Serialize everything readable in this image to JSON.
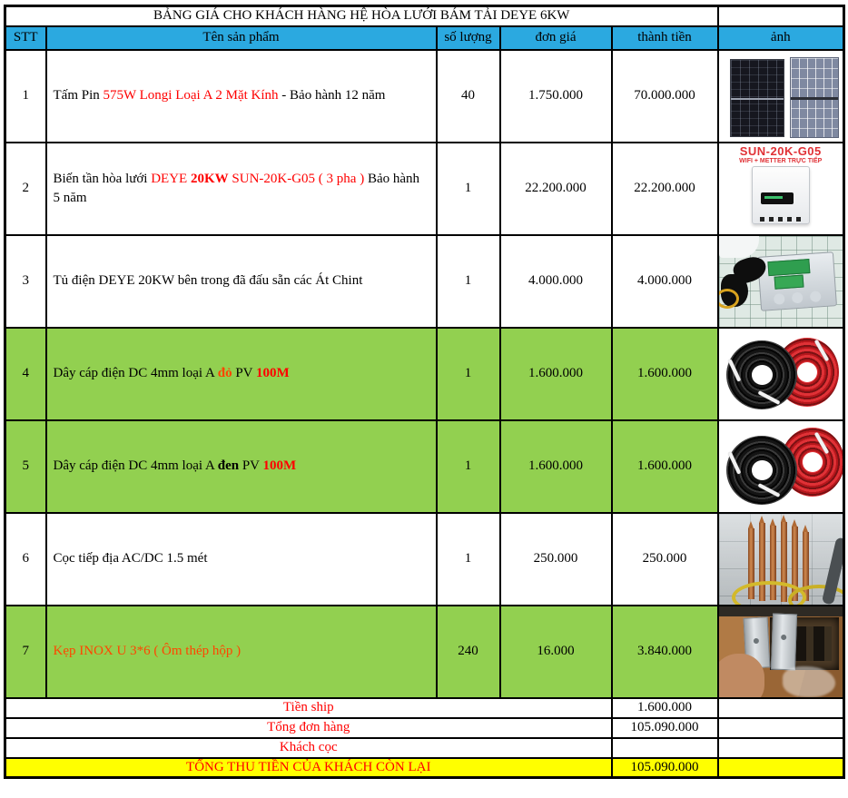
{
  "title": "BẢNG GIÁ CHO KHÁCH HÀNG HỆ HÒA LƯỚI BÁM TẢI DEYE 6KW",
  "columns": {
    "stt": "STT",
    "product": "Tên sản phẩm",
    "qty": "số lượng",
    "unit_price": "đơn giá",
    "total": "thành tiền",
    "image": "ảnh"
  },
  "colors": {
    "header_bg": "#2BA9E0",
    "highlight_green": "#92D050",
    "highlight_yellow": "#FFFF00",
    "red": "#FF0000",
    "orange_red": "#FF4500"
  },
  "rows": [
    {
      "stt": "1",
      "name_parts": [
        {
          "t": "Tấm Pin ",
          "s": "plain"
        },
        {
          "t": "575W Longi Loại A 2 Mặt Kính",
          "s": "red"
        },
        {
          "t": " - Bảo hành 12 năm",
          "s": "plain"
        }
      ],
      "qty": "40",
      "unit_price": "1.750.000",
      "total": "70.000.000",
      "highlight": false,
      "image": "solar-panels"
    },
    {
      "stt": "2",
      "name_parts": [
        {
          "t": "Biến tần hòa lưới ",
          "s": "plain"
        },
        {
          "t": "DEYE ",
          "s": "red"
        },
        {
          "t": "20KW",
          "s": "red-bold"
        },
        {
          "t": " SUN-20K-G05 ( 3 pha ) ",
          "s": "red"
        },
        {
          "t": " Bảo hành 5 năm",
          "s": "plain"
        }
      ],
      "qty": "1",
      "unit_price": "22.200.000",
      "total": "22.200.000",
      "highlight": false,
      "image": "inverter",
      "image_labels": {
        "model": "SUN-20K-G05",
        "subtitle": "WIFI + METTER TRỰC TIẾP"
      }
    },
    {
      "stt": "3",
      "name_parts": [
        {
          "t": "Tủ điện DEYE 20KW bên trong đã đấu sẵn các Át Chint",
          "s": "plain"
        }
      ],
      "qty": "1",
      "unit_price": "4.000.000",
      "total": "4.000.000",
      "highlight": false,
      "image": "electrical-box"
    },
    {
      "stt": "4",
      "name_parts": [
        {
          "t": "Dây cáp điện DC 4mm loại A ",
          "s": "plain"
        },
        {
          "t": "đỏ",
          "s": "orange-bold"
        },
        {
          "t": " PV ",
          "s": "plain"
        },
        {
          "t": "100M",
          "s": "red-bold"
        }
      ],
      "qty": "1",
      "unit_price": "1.600.000",
      "total": "1.600.000",
      "highlight": true,
      "image": "cables-red-black"
    },
    {
      "stt": "5",
      "name_parts": [
        {
          "t": "Dây cáp điện DC 4mm loại A ",
          "s": "plain"
        },
        {
          "t": "đen",
          "s": "bold"
        },
        {
          "t": " PV ",
          "s": "plain"
        },
        {
          "t": "100M",
          "s": "red-bold"
        }
      ],
      "qty": "1",
      "unit_price": "1.600.000",
      "total": "1.600.000",
      "highlight": true,
      "image": "cables-black-red"
    },
    {
      "stt": "6",
      "name_parts": [
        {
          "t": "Cọc tiếp địa AC/DC 1.5 mét",
          "s": "plain"
        }
      ],
      "qty": "1",
      "unit_price": "250.000",
      "total": "250.000",
      "highlight": false,
      "image": "copper-rods"
    },
    {
      "stt": "7",
      "name_parts": [
        {
          "t": "Kẹp INOX U 3*6 ( Ôm thép hộp )",
          "s": "orange"
        }
      ],
      "qty": "240",
      "unit_price": "16.000",
      "total": "3.840.000",
      "highlight": true,
      "image": "inox-clamp"
    }
  ],
  "summary": [
    {
      "label": "Tiền ship",
      "total": "1.600.000",
      "highlight": false
    },
    {
      "label": "Tổng đơn hàng",
      "total": "105.090.000",
      "highlight": false
    },
    {
      "label": "Khách cọc",
      "total": "",
      "highlight": false
    },
    {
      "label": "TỔNG THU TIỀN CỦA KHÁCH CÒN LẠI",
      "total": "105.090.000",
      "highlight": true
    }
  ]
}
